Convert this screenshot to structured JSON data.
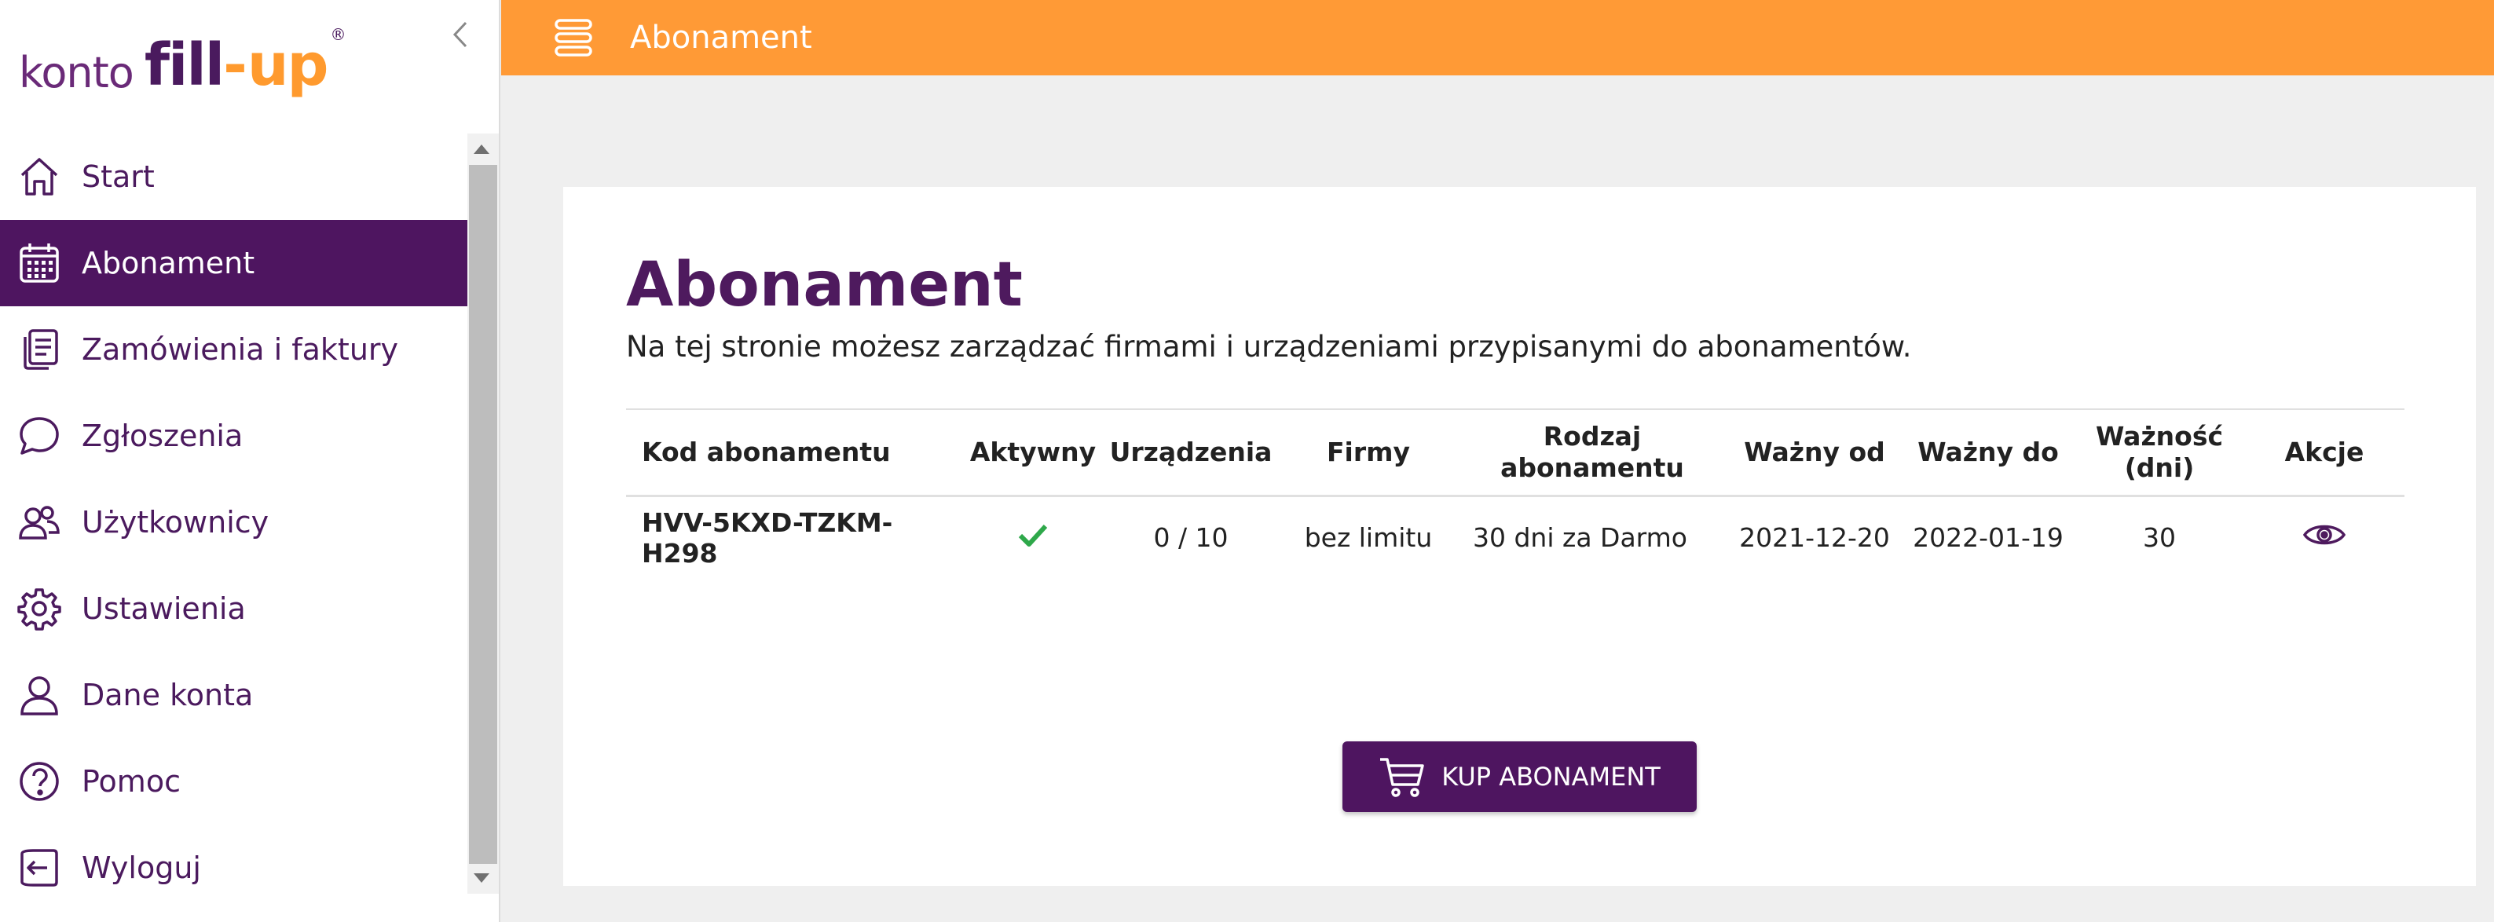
{
  "logo": {
    "konto": "konto",
    "fill": "fill",
    "dash": "-",
    "up": "up",
    "reg": "®"
  },
  "topbar": {
    "title": "Abonament",
    "menu_icon": "menu-icon"
  },
  "sidebar": {
    "collapse_icon": "chevron-left-icon",
    "items": [
      {
        "label": "Start",
        "icon": "home-icon",
        "active": false
      },
      {
        "label": "Abonament",
        "icon": "calendar-icon",
        "active": true
      },
      {
        "label": "Zamówienia i faktury",
        "icon": "documents-icon",
        "active": false
      },
      {
        "label": "Zgłoszenia",
        "icon": "chat-icon",
        "active": false
      },
      {
        "label": "Użytkownicy",
        "icon": "users-icon",
        "active": false
      },
      {
        "label": "Ustawienia",
        "icon": "gear-icon",
        "active": false
      },
      {
        "label": "Dane konta",
        "icon": "user-icon",
        "active": false
      },
      {
        "label": "Pomoc",
        "icon": "help-icon",
        "active": false
      },
      {
        "label": "Wyloguj",
        "icon": "logout-icon",
        "active": false
      }
    ]
  },
  "main": {
    "title": "Abonament",
    "description": "Na tej stronie możesz zarządzać firmami i urządzeniami przypisanymi do abonamentów.",
    "table": {
      "headers": [
        "Kod abonamentu",
        "Aktywny",
        "Urządzenia",
        "Firmy",
        "Rodzaj abonamentu",
        "Ważny od",
        "Ważny do",
        "Ważność (dni)",
        "Akcje"
      ],
      "rows": [
        {
          "code": "HVV-5KXD-TZKM-H298",
          "active": true,
          "devices": "0 / 10",
          "companies": "bez limitu",
          "type": "30 dni za Darmo",
          "valid_from": "2021-12-20",
          "valid_to": "2022-01-19",
          "validity_days": "30",
          "action_icon": "eye-icon"
        }
      ]
    },
    "buy_button": "KUP ABONAMENT"
  },
  "colors": {
    "brand_purple": "#4e1560",
    "accent_orange": "#ff9a36",
    "check_green": "#2ea84a"
  }
}
